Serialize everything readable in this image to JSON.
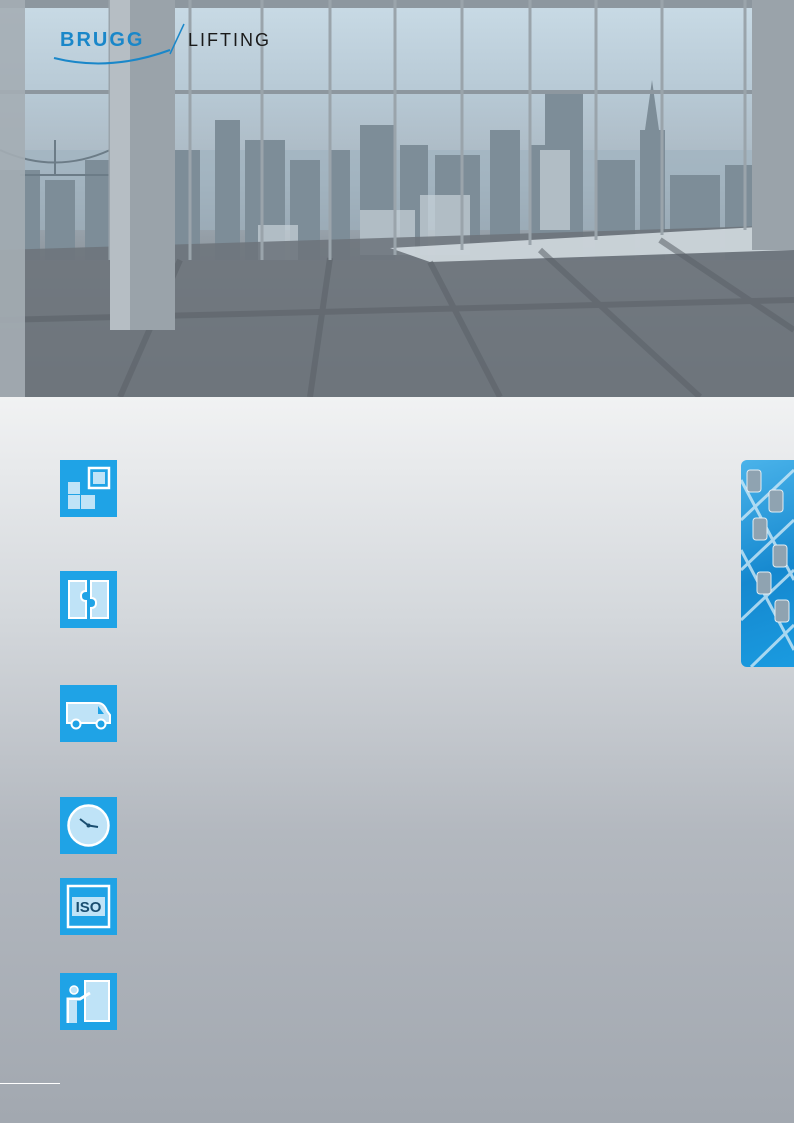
{
  "logo": {
    "brand": "BRUGG",
    "product": "LIFTING",
    "brand_color": "#1a87c9"
  },
  "hero": {
    "description_icon": "city-skyline-photo"
  },
  "icons": [
    {
      "name": "modules-icon"
    },
    {
      "name": "puzzle-icon"
    },
    {
      "name": "delivery-van-icon"
    },
    {
      "name": "clock-icon"
    },
    {
      "name": "iso-icon",
      "label": "ISO"
    },
    {
      "name": "training-presenter-icon"
    }
  ],
  "colors": {
    "accent": "#1fa3e6",
    "background": "#a4aab2"
  }
}
